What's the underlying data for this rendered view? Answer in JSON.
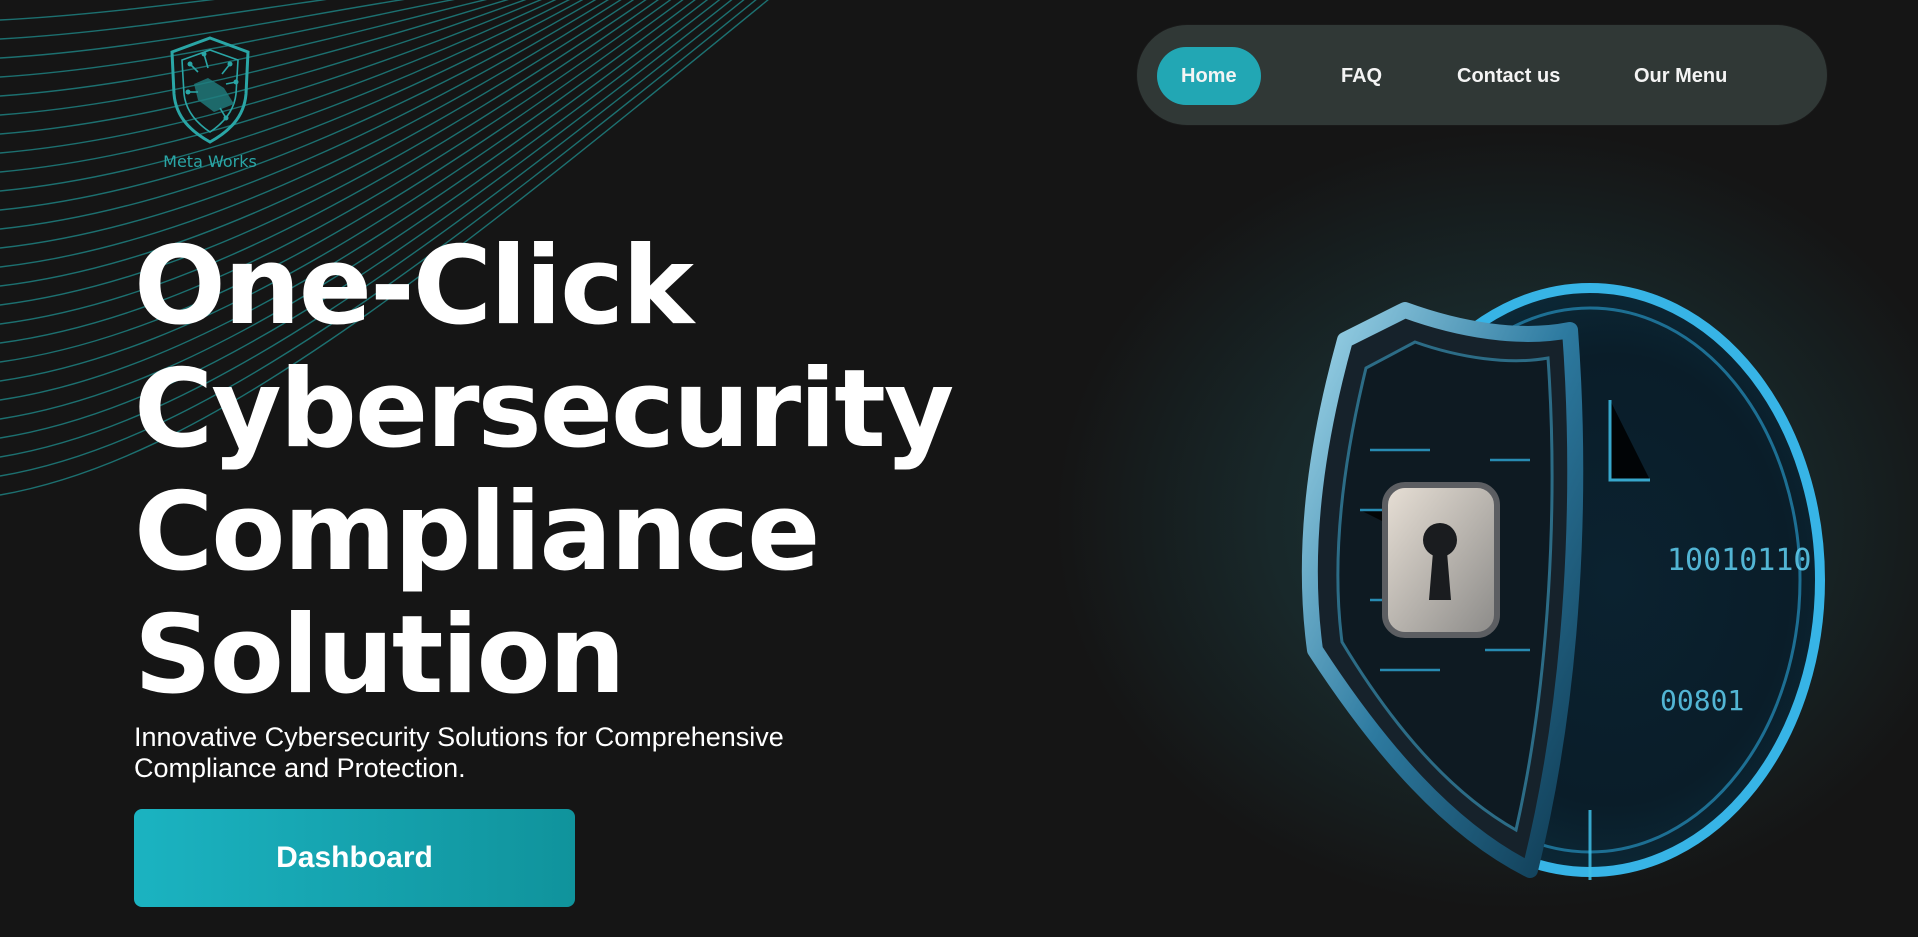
{
  "brand": {
    "name": "Meta Works",
    "accent": "#22a7b4"
  },
  "nav": {
    "items": [
      {
        "label": "Home",
        "active": true
      },
      {
        "label": "FAQ",
        "active": false
      },
      {
        "label": "Contact us",
        "active": false
      },
      {
        "label": "Our Menu",
        "active": false
      }
    ]
  },
  "hero": {
    "headline": [
      "One-Click",
      "Cybersecurity",
      "Compliance",
      "Solution"
    ],
    "subtitle_lines": [
      "Innovative Cybersecurity Solutions for Comprehensive",
      "Compliance and Protection."
    ],
    "cta_label": "Dashboard"
  },
  "art": {
    "icon": "shield-lock-icon",
    "printed_text": [
      "10010110",
      "00801"
    ]
  }
}
